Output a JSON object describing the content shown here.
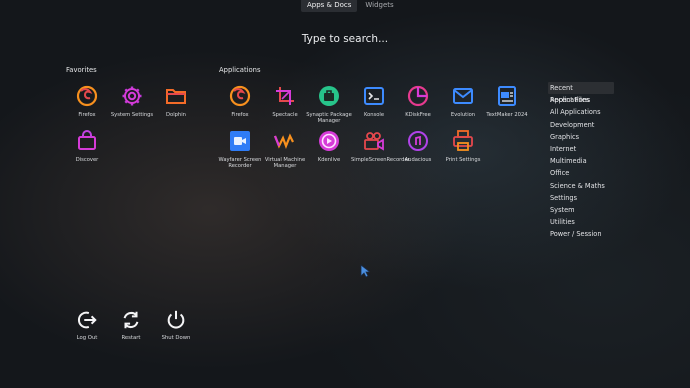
{
  "tabs": {
    "apps_docs": "Apps & Docs",
    "widgets": "Widgets"
  },
  "search": {
    "placeholder": "Type to search..."
  },
  "favorites": {
    "title": "Favorites",
    "items": [
      "Firefox",
      "System Settings",
      "Dolphin",
      "Discover"
    ]
  },
  "applications": {
    "title": "Applications",
    "items": [
      "Firefox",
      "Spectacle",
      "Synaptic Package Manager",
      "Konsole",
      "KDiskFree",
      "Evolution",
      "TextMaker 2024",
      "Wayfarer Screen Recorder",
      "Virtual Machine Manager",
      "Kdenlive",
      "SimpleScreenRecorder",
      "Audacious",
      "Print Settings"
    ]
  },
  "categories": [
    "Recent Applications",
    "Recent Files",
    "All Applications",
    "Development",
    "Graphics",
    "Internet",
    "Multimedia",
    "Office",
    "Science & Maths",
    "Settings",
    "System",
    "Utilities",
    "Power / Session"
  ],
  "power": {
    "logout": "Log Out",
    "restart": "Restart",
    "shutdown": "Shut Down"
  },
  "colors": {
    "orange": "#f7901e",
    "magenta": "#d63bd8",
    "blue": "#3d8bff",
    "green": "#27c48a"
  }
}
